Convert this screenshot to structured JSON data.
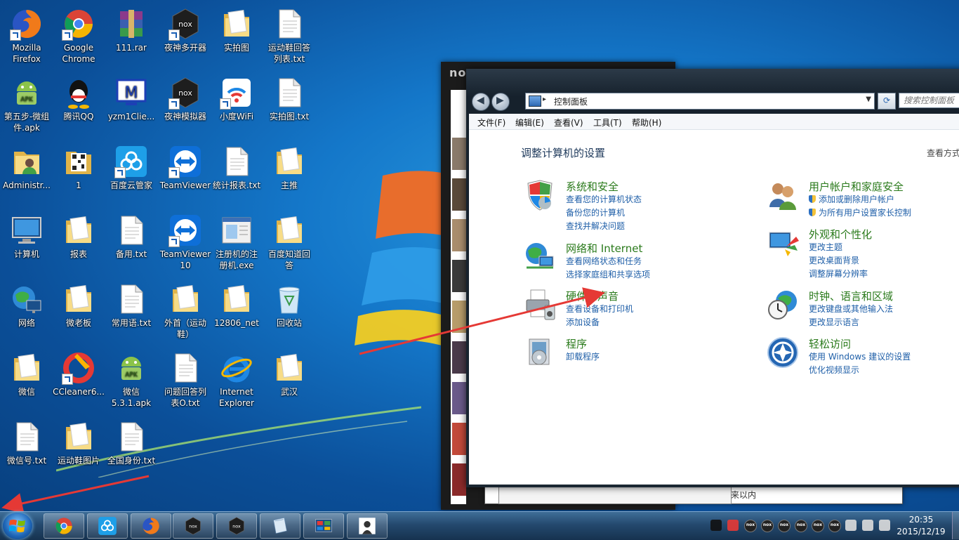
{
  "desktop": {
    "icons": [
      {
        "label": "Mozilla\nFirefox",
        "icon": "firefox-icon"
      },
      {
        "label": "Google\nChrome",
        "icon": "chrome-icon"
      },
      {
        "label": "111.rar",
        "icon": "winrar-icon"
      },
      {
        "label": "夜神多开器",
        "icon": "nox-icon"
      },
      {
        "label": "实拍图",
        "icon": "folder-icon"
      },
      {
        "label": "运动鞋回答\n列表.txt",
        "icon": "txt-file-icon"
      },
      {
        "label": "第五步-微组\n件.apk",
        "icon": "apk-icon"
      },
      {
        "label": "腾讯QQ",
        "icon": "qq-icon"
      },
      {
        "label": "yzm1Clie...",
        "icon": "monitor-m-icon"
      },
      {
        "label": "夜神模拟器",
        "icon": "nox-icon"
      },
      {
        "label": "小度WiFi",
        "icon": "wifi-icon"
      },
      {
        "label": "实拍图.txt",
        "icon": "txt-file-icon"
      },
      {
        "label": "Administr...",
        "icon": "user-folder-icon"
      },
      {
        "label": "1",
        "icon": "qr-folder-icon"
      },
      {
        "label": "百度云管家",
        "icon": "baidu-cloud-icon"
      },
      {
        "label": "TeamViewer",
        "icon": "teamviewer-icon"
      },
      {
        "label": "统计报表.txt",
        "icon": "txt-file-icon"
      },
      {
        "label": "主推",
        "icon": "folder-icon"
      },
      {
        "label": "计算机",
        "icon": "computer-icon"
      },
      {
        "label": "报表",
        "icon": "folder-icon"
      },
      {
        "label": "备用.txt",
        "icon": "txt-file-icon"
      },
      {
        "label": "TeamViewer\n10",
        "icon": "teamviewer-icon"
      },
      {
        "label": "注册机的注\n册机.exe",
        "icon": "exe-icon"
      },
      {
        "label": "百度知道回\n答",
        "icon": "folder-icon"
      },
      {
        "label": "网络",
        "icon": "network-icon"
      },
      {
        "label": "微老板",
        "icon": "folder-icon"
      },
      {
        "label": "常用语.txt",
        "icon": "txt-file-icon"
      },
      {
        "label": "外首（运动\n鞋）",
        "icon": "folder-icon"
      },
      {
        "label": "12806_net",
        "icon": "folder-icon"
      },
      {
        "label": "回收站",
        "icon": "recycle-bin-icon"
      },
      {
        "label": "微信",
        "icon": "folder-icon"
      },
      {
        "label": "CCleaner6...",
        "icon": "ccleaner-icon"
      },
      {
        "label": "微信\n5.3.1.apk",
        "icon": "apk-icon"
      },
      {
        "label": "问题回答列\n表O.txt",
        "icon": "txt-file-icon"
      },
      {
        "label": "Internet\nExplorer",
        "icon": "ie-icon"
      },
      {
        "label": "武汉",
        "icon": "folder-icon"
      },
      {
        "label": "微信号.txt",
        "icon": "txt-file-icon"
      },
      {
        "label": "运动鞋图片",
        "icon": "folder-icon"
      },
      {
        "label": "全国身份.txt",
        "icon": "txt-file-icon"
      }
    ]
  },
  "nox_window": {
    "title": "nox"
  },
  "bottom_window": {
    "text": "来以内"
  },
  "control_panel": {
    "address": "控制面板",
    "search_placeholder": "搜索控制面板",
    "menu": [
      "文件(F)",
      "编辑(E)",
      "查看(V)",
      "工具(T)",
      "帮助(H)"
    ],
    "heading": "调整计算机的设置",
    "view_by": "查看方式",
    "categories": [
      {
        "title": "系统和安全",
        "icon": "security-shield-icon",
        "links": [
          "查看您的计算机状态",
          "备份您的计算机",
          "查找并解决问题"
        ]
      },
      {
        "title": "网络和 Internet",
        "icon": "network-globe-icon",
        "links": [
          "查看网络状态和任务",
          "选择家庭组和共享选项"
        ]
      },
      {
        "title": "硬件和声音",
        "icon": "printer-icon",
        "links": [
          "查看设备和打印机",
          "添加设备"
        ]
      },
      {
        "title": "程序",
        "icon": "programs-icon",
        "links": [
          "卸载程序"
        ]
      },
      {
        "title": "用户帐户和家庭安全",
        "icon": "users-icon",
        "links": [
          "添加或删除用户帐户",
          "为所有用户设置家长控制"
        ]
      },
      {
        "title": "外观和个性化",
        "icon": "appearance-icon",
        "links": [
          "更改主题",
          "更改桌面背景",
          "调整屏幕分辨率"
        ]
      },
      {
        "title": "时钟、语言和区域",
        "icon": "clock-globe-icon",
        "links": [
          "更改键盘或其他输入法",
          "更改显示语言"
        ]
      },
      {
        "title": "轻松访问",
        "icon": "ease-of-access-icon",
        "links": [
          "使用 Windows 建议的设置",
          "优化视频显示"
        ]
      }
    ]
  },
  "taskbar": {
    "items": [
      "chrome-icon",
      "baidu-cloud-icon",
      "firefox-icon",
      "nox-icon",
      "nox-icon",
      "notepad-icon",
      "control-panel-icon",
      "photo-viewer-icon"
    ],
    "clock_time": "20:35",
    "clock_date": "2015/12/19"
  },
  "colors": {
    "link": "#1f5fa8",
    "category_title": "#2a7a1b",
    "arrow": "#e53935"
  }
}
